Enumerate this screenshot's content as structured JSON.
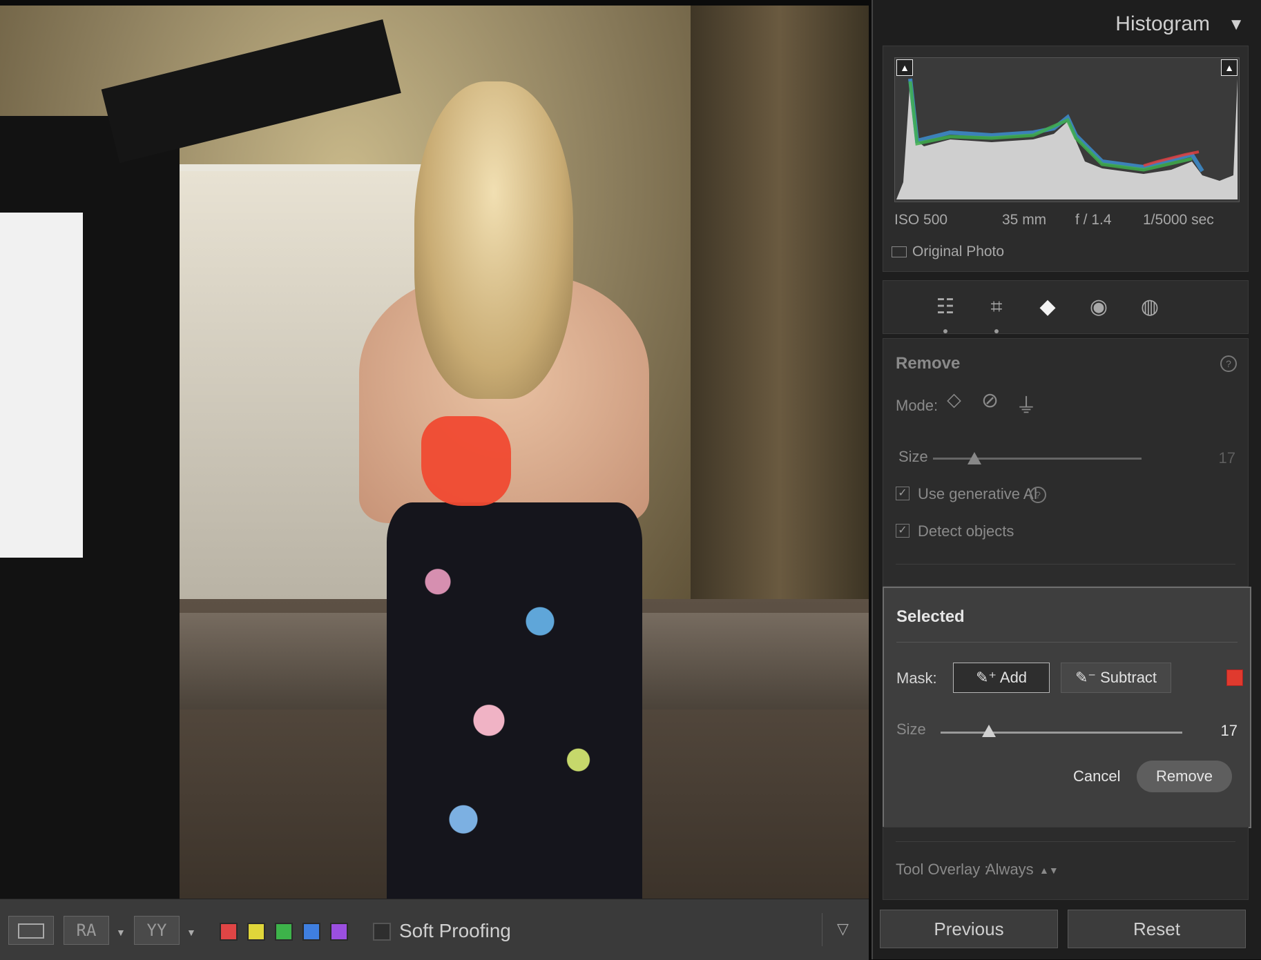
{
  "panel": {
    "header_title": "Histogram",
    "exif": {
      "iso": "ISO 500",
      "focal": "35 mm",
      "aperture": "f / 1.4",
      "shutter": "1/5000 sec"
    },
    "original_photo": "Original Photo",
    "tools": [
      "edit-sliders-icon",
      "crop-icon",
      "eraser-icon",
      "red-eye-icon",
      "masking-icon"
    ],
    "remove": {
      "title": "Remove",
      "mode_label": "Mode:",
      "size_label": "Size",
      "size_value": "17",
      "size_fraction": 0.2,
      "use_gen_ai": "Use generative AI",
      "detect_objects": "Detect objects"
    },
    "selected": {
      "title": "Selected",
      "mask_label": "Mask:",
      "add": "Add",
      "subtract": "Subtract",
      "size_label": "Size",
      "size_value": "17",
      "size_fraction": 0.2,
      "cancel": "Cancel",
      "remove": "Remove"
    },
    "tool_overlay": {
      "label": "Tool Overlay :",
      "value": "Always"
    },
    "previous": "Previous",
    "reset": "Reset",
    "accent_color": "#e03a2e"
  },
  "toolbar": {
    "ra": "RA",
    "yy": "YY",
    "color_labels": [
      "#e04545",
      "#e0d63a",
      "#3db34a",
      "#3f7fe0",
      "#9b4fe0"
    ],
    "soft_proofing": "Soft Proofing"
  }
}
